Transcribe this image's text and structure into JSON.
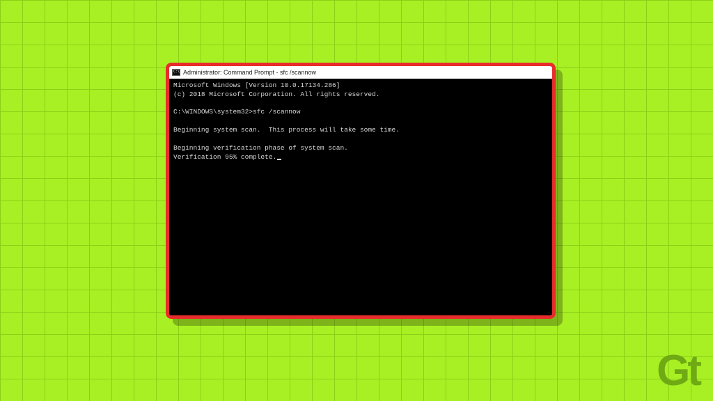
{
  "window": {
    "title": "Administrator: Command Prompt - sfc  /scannow"
  },
  "terminal": {
    "line_version": "Microsoft Windows [Version 10.0.17134.286]",
    "line_copyright": "(c) 2018 Microsoft Corporation. All rights reserved.",
    "prompt_path": "C:\\WINDOWS\\system32>",
    "command": "sfc /scannow",
    "line_begin_scan": "Beginning system scan.  This process will take some time.",
    "line_begin_verify": "Beginning verification phase of system scan.",
    "line_progress": "Verification 95% complete."
  },
  "logo": {
    "text": "Gt"
  }
}
